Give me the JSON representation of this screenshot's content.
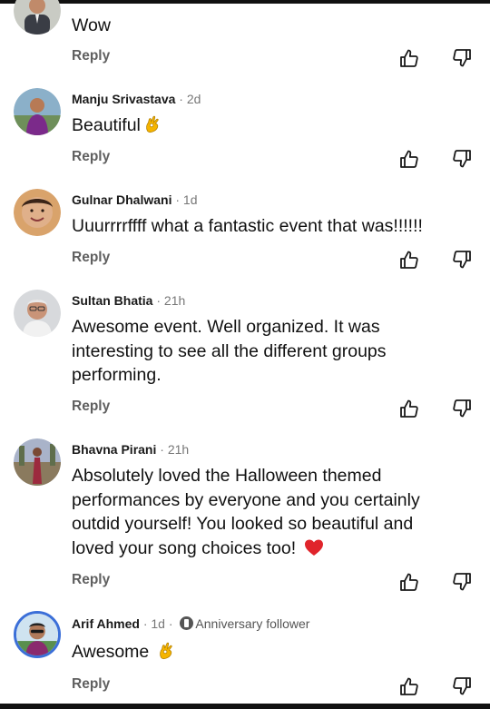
{
  "comments": [
    {
      "author": "",
      "time": "",
      "text": "Wow",
      "emoji": "",
      "reply_label": "Reply",
      "avatar": "man-in-suit-avatar"
    },
    {
      "author": "Manju Srivastava",
      "separator": "·",
      "time": "2d",
      "text": "Beautiful",
      "emoji": "ok-hand-emoji",
      "reply_label": "Reply",
      "avatar": "woman-purple-sari-avatar"
    },
    {
      "author": "Gulnar Dhalwani",
      "separator": "·",
      "time": "1d",
      "text": "Uuurrrrffff what a fantastic event that was!!!!!!",
      "emoji": "",
      "reply_label": "Reply",
      "avatar": "smiling-woman-avatar"
    },
    {
      "author": "Sultan Bhatia",
      "separator": "·",
      "time": "21h",
      "text": "Awesome event. Well organized. It was interesting to see all the different groups performing.",
      "emoji": "",
      "reply_label": "Reply",
      "avatar": "man-with-glasses-avatar"
    },
    {
      "author": "Bhavna Pirani",
      "separator": "·",
      "time": "21h",
      "text": "Absolutely loved the Halloween themed performances by everyone and you certainly outdid yourself! You looked so beautiful and loved your song choices too!",
      "emoji": "red-heart-emoji",
      "reply_label": "Reply",
      "avatar": "woman-outdoor-avatar"
    },
    {
      "author": "Arif Ahmed",
      "separator": "·",
      "time": "1d",
      "separator2": "·",
      "badge": "Anniversary follower",
      "text": "Awesome",
      "emoji": "ok-hand-emoji",
      "reply_label": "Reply",
      "avatar": "man-with-sunglasses-avatar"
    }
  ],
  "colors": {
    "meta_gray": "#777777",
    "reply_gray": "#606060",
    "avatar_ring_blue": "#3b6fd8",
    "heart_red": "#e0242b",
    "ok_hand_yellow": "#f5b400"
  }
}
